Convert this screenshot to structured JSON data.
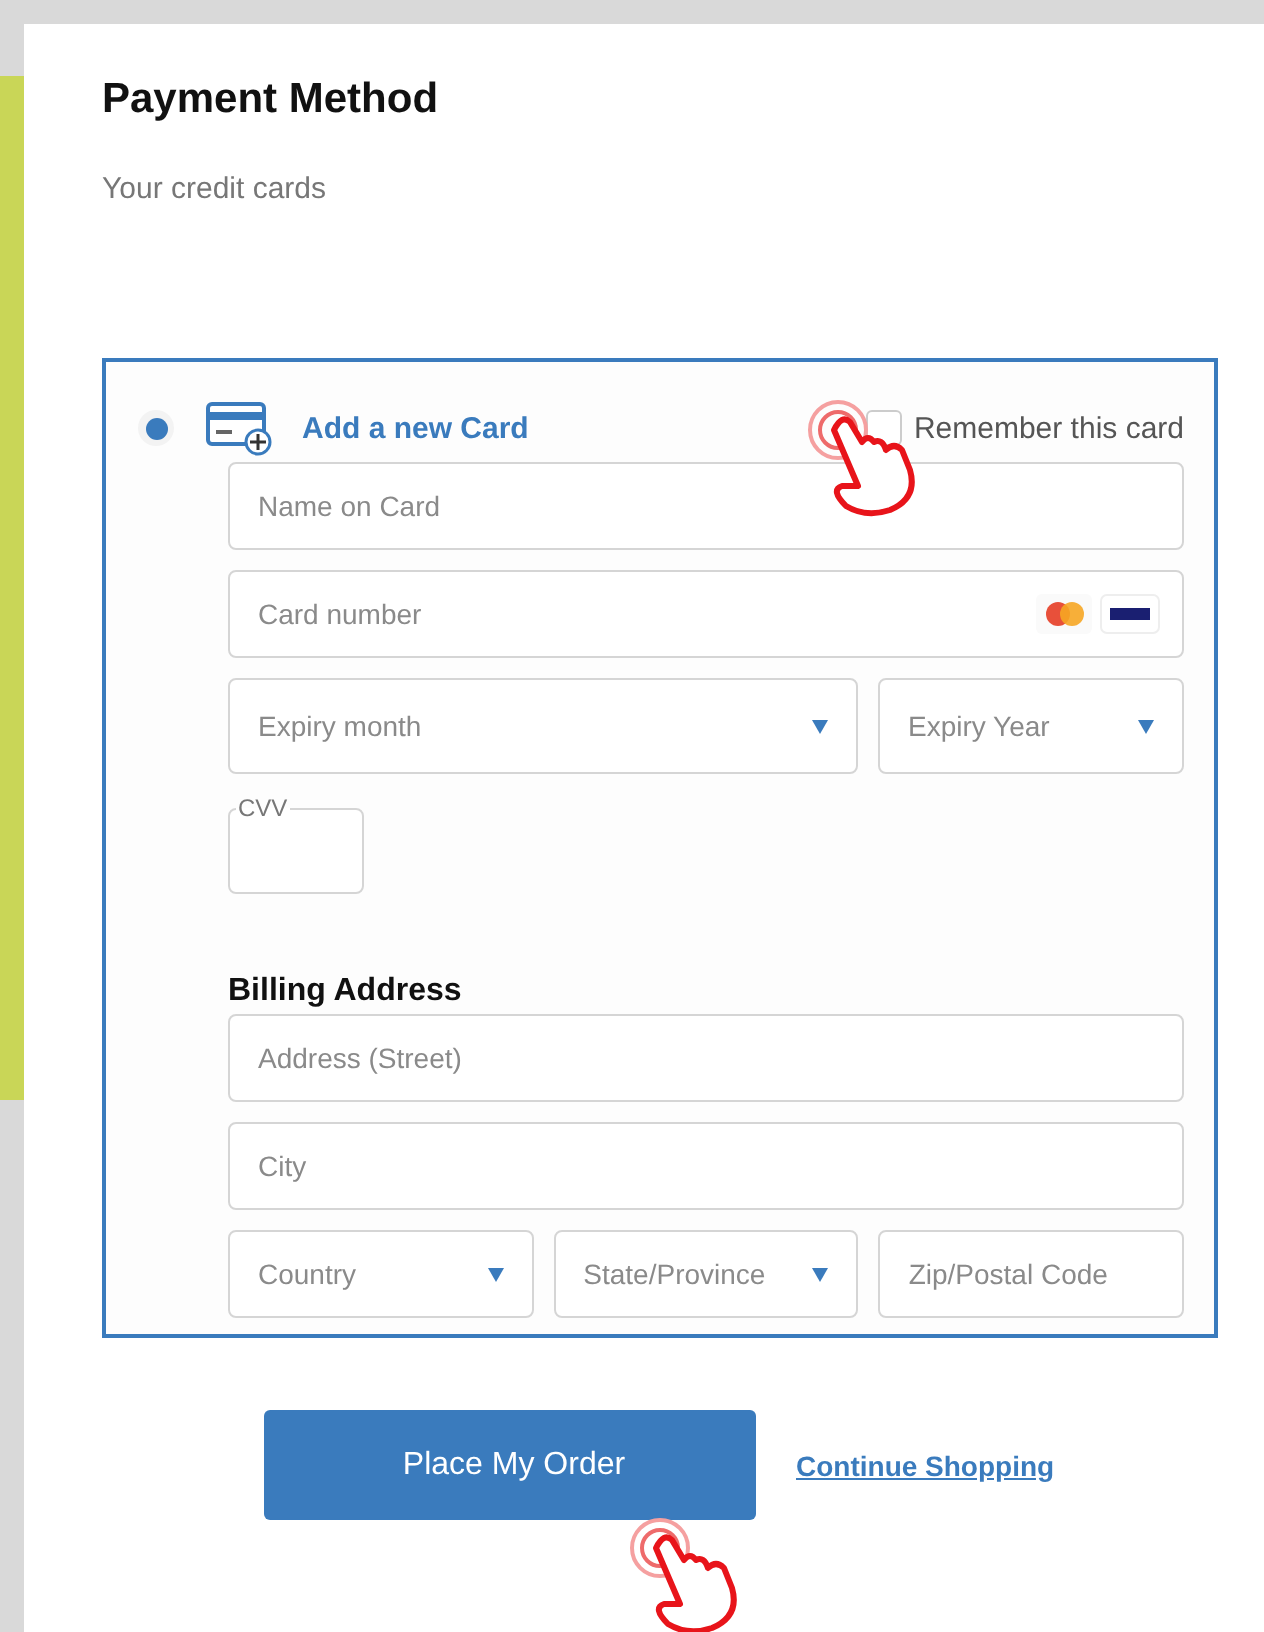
{
  "title": "Payment Method",
  "subtitle": "Your credit cards",
  "new_card": {
    "selected": true,
    "label": "Add a new Card"
  },
  "remember": {
    "label": "Remember this card",
    "checked": false
  },
  "card_fields": [
    {
      "kind": "text",
      "placeholder": "Name on Card"
    },
    {
      "kind": "card",
      "placeholder": "Card number"
    }
  ],
  "expiry": [
    {
      "placeholder": "Expiry month"
    },
    {
      "placeholder": "Expiry Year"
    }
  ],
  "cvv": {
    "label": "CVV"
  },
  "billing": {
    "heading": "Billing Address",
    "fields": [
      {
        "placeholder": "Address (Street)"
      },
      {
        "placeholder": "City"
      }
    ],
    "row": [
      {
        "kind": "select",
        "placeholder": "Country"
      },
      {
        "kind": "select",
        "placeholder": "State/Province"
      },
      {
        "kind": "text",
        "placeholder": "Zip/Postal Code"
      }
    ]
  },
  "place_order": "Place My Order",
  "continue_link": "Continue Shopping"
}
